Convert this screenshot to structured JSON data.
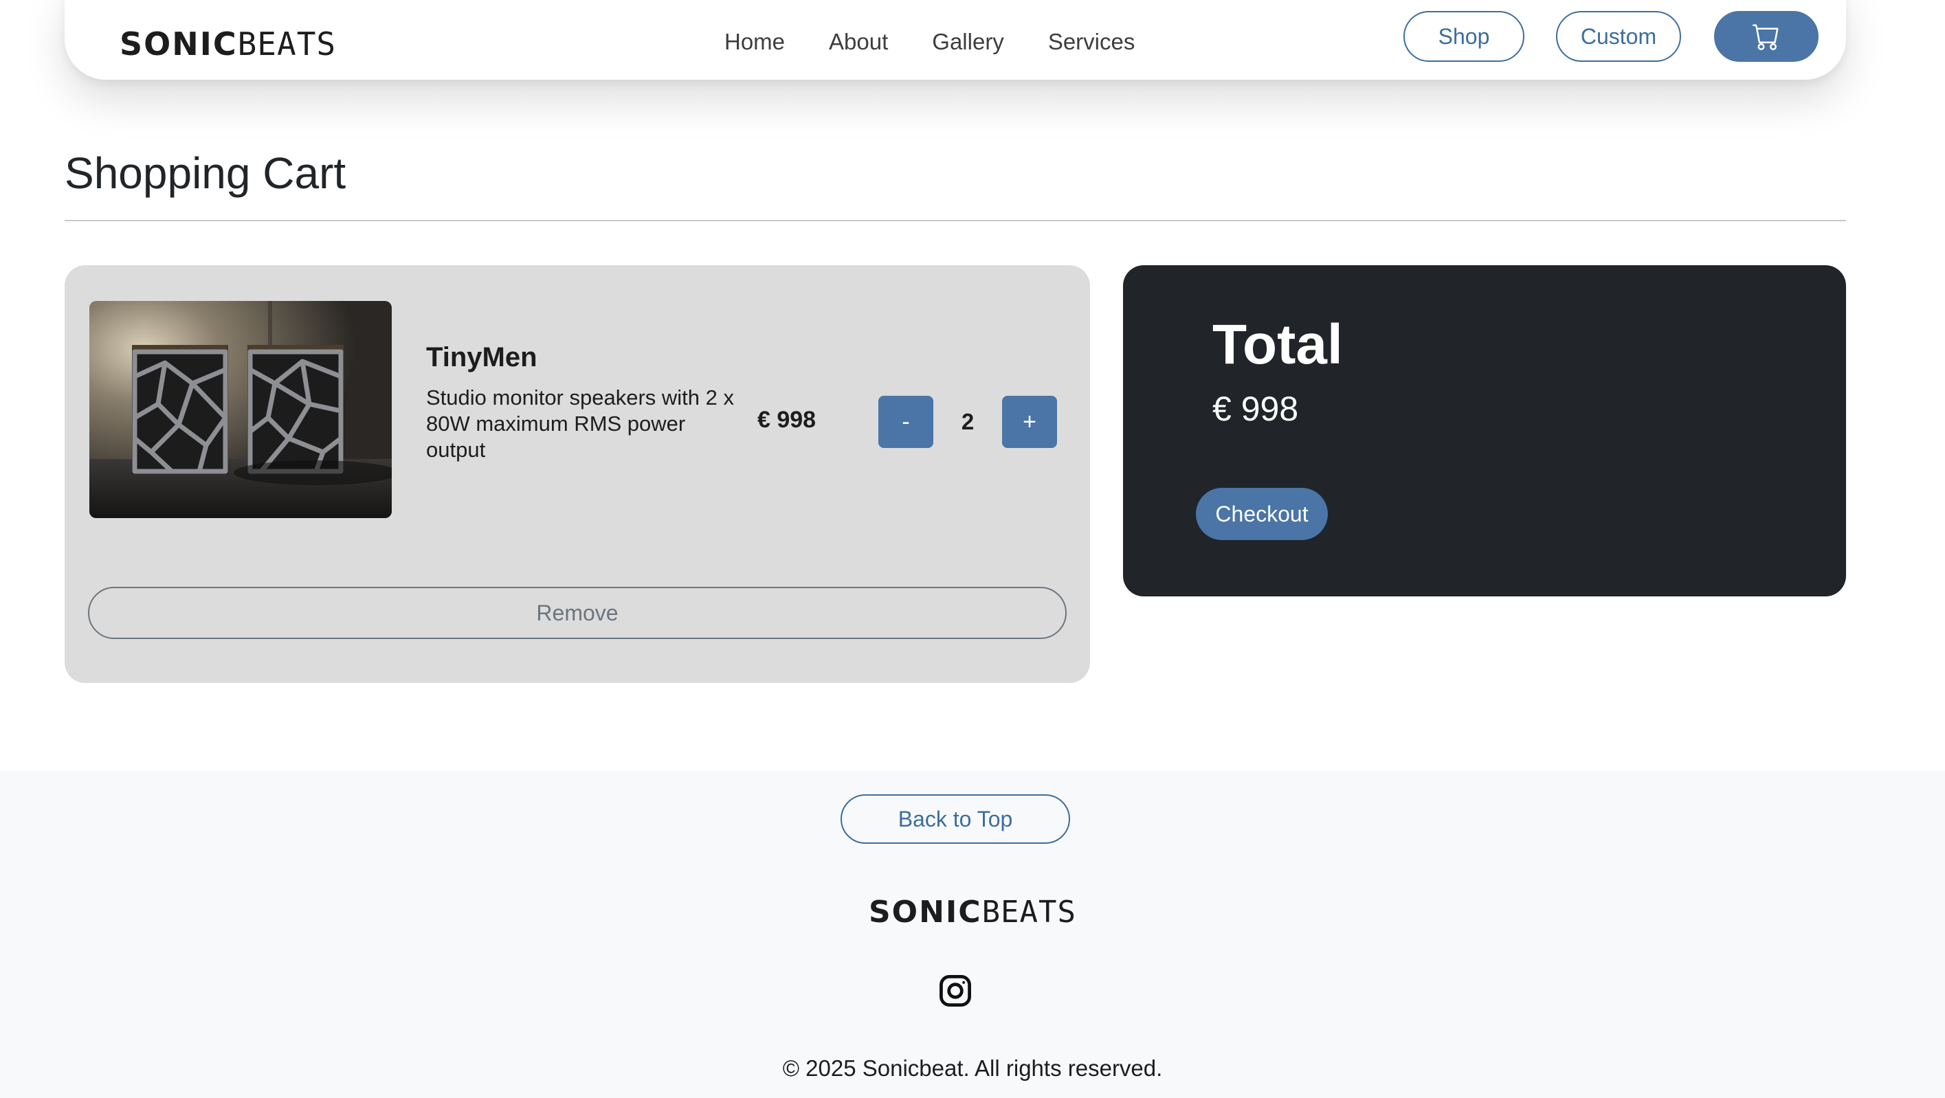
{
  "navbar": {
    "brand_bold": "SONIC",
    "brand_thin": "BEATS",
    "links": [
      "Home",
      "About",
      "Gallery",
      "Services"
    ],
    "shop_label": "Shop",
    "custom_label": "Custom",
    "cart_icon": "cart-icon"
  },
  "page": {
    "title": "Shopping Cart"
  },
  "cart": {
    "items": [
      {
        "name": "TinyMen",
        "description": "Studio monitor speakers with 2 x 80W maximum RMS power output",
        "price": "€ 998",
        "quantity": "2",
        "minus_label": "-",
        "plus_label": "+",
        "remove_label": "Remove"
      }
    ]
  },
  "summary": {
    "title": "Total",
    "amount": "€ 998",
    "checkout_label": "Checkout"
  },
  "footer": {
    "back_to_top_label": "Back to Top",
    "brand_bold": "SONIC",
    "brand_thin": "BEATS",
    "social_icon": "instagram-icon",
    "copyright": "© 2025 Sonicbeat. All rights reserved."
  },
  "colors": {
    "accent": "#4a75a6",
    "accent_outline": "#3c6e9e",
    "dark_card": "#212529",
    "item_card": "#dcdcdc",
    "footer_bg": "#f8f9fa"
  }
}
